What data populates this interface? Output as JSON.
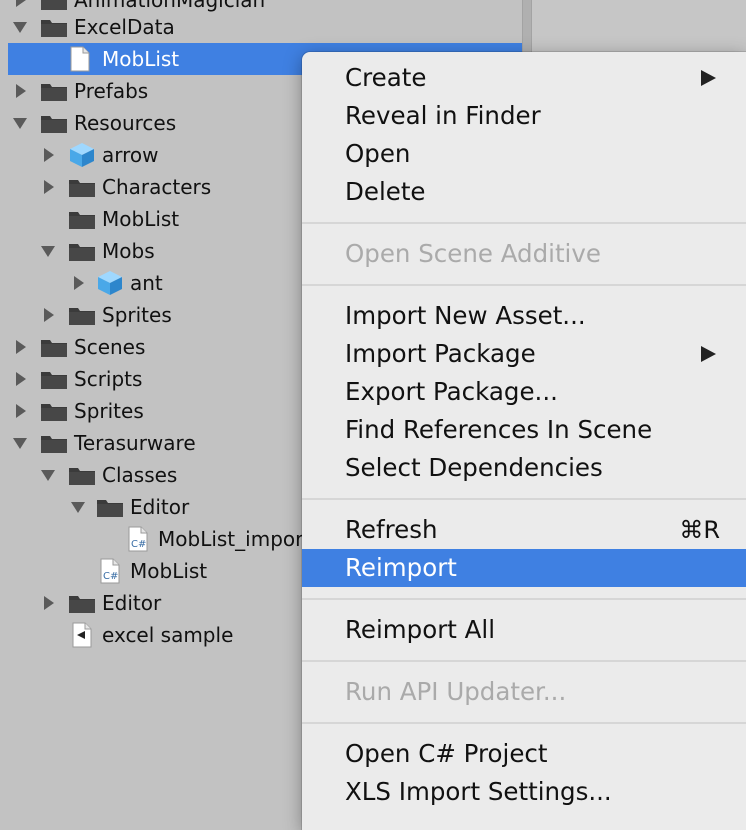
{
  "tree": {
    "top_partial_label": "AnimationMagician",
    "items": [
      {
        "label": "ExcelData"
      },
      {
        "label": "MobList"
      },
      {
        "label": "Prefabs"
      },
      {
        "label": "Resources"
      },
      {
        "label": "arrow"
      },
      {
        "label": "Characters"
      },
      {
        "label": "MobList"
      },
      {
        "label": "Mobs"
      },
      {
        "label": "ant"
      },
      {
        "label": "Sprites"
      },
      {
        "label": "Scenes"
      },
      {
        "label": "Scripts"
      },
      {
        "label": "Sprites"
      },
      {
        "label": "Terasurware"
      },
      {
        "label": "Classes"
      },
      {
        "label": "Editor"
      },
      {
        "label": "MobList_importer"
      },
      {
        "label": "MobList"
      },
      {
        "label": "Editor"
      },
      {
        "label": "excel sample"
      }
    ]
  },
  "context_menu": {
    "create": "Create",
    "reveal": "Reveal in Finder",
    "open": "Open",
    "delete": "Delete",
    "open_scene_additive": "Open Scene Additive",
    "import_new_asset": "Import New Asset...",
    "import_package": "Import Package",
    "export_package": "Export Package...",
    "find_references": "Find References In Scene",
    "select_dependencies": "Select Dependencies",
    "refresh": "Refresh",
    "refresh_shortcut": "⌘R",
    "reimport": "Reimport",
    "reimport_all": "Reimport All",
    "run_api_updater": "Run API Updater...",
    "open_csharp_project": "Open C# Project",
    "xls_import_settings": "XLS Import Settings..."
  },
  "colors": {
    "selection": "#3f80e2",
    "menu_bg": "#ebebeb",
    "pane_bg": "#c2c2c2",
    "folder": "#3b3b3b",
    "prefab_cube": "#4aa8e8"
  }
}
